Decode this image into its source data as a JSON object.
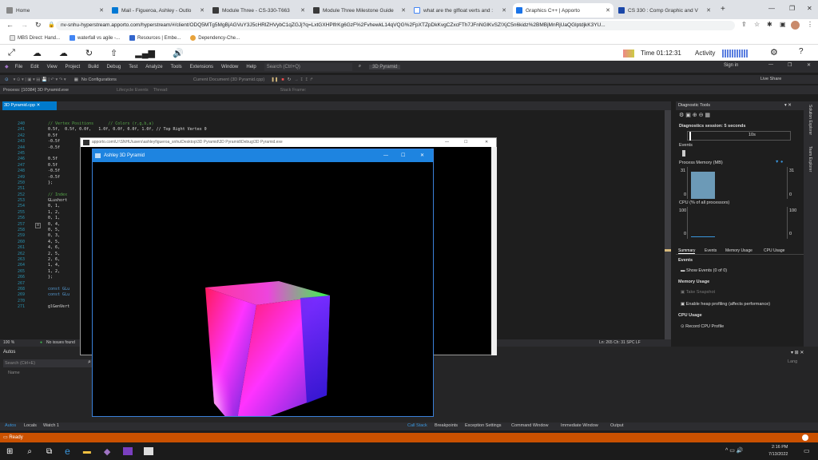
{
  "browser": {
    "tabs": [
      {
        "label": "Home",
        "color": "#888"
      },
      {
        "label": "Mail - Figueroa, Ashley - Outlo",
        "color": "#0078d4"
      },
      {
        "label": "Module Three - CS-330-T663",
        "color": "#3a3a3a"
      },
      {
        "label": "Module Three Milestone Guide",
        "color": "#3a3a3a"
      },
      {
        "label": "what are the glfloat verts and :",
        "color": "#4285f4"
      },
      {
        "label": "Graphics C++ | Apporto",
        "color": "#1a73e8"
      },
      {
        "label": "CS 330 : Comp Graphic and V",
        "color": "#1a47a8"
      }
    ],
    "url": "nv-snhu-hyperstream.apporto.com/hyperstream/#/client/ODQ5MTg5MgBjAGVuY3J5cHRlZHVybC1qZGJj?q=LxtGXHPlfrKg6GzF%2FvhewkL14qVQG%2FpXTZpDkKvgCZxcFTh7JFnNGlKvSZ!XjC5n6kidz%2BMBjMnRjUaQGlptdjkK3YU...",
    "bookmarks": [
      "MBS Direct: Hand...",
      "waterfall vs agile -...",
      "Resources | Embe...",
      "Dependency-Che..."
    ]
  },
  "rdp": {
    "time_label": "Time 01:12:31",
    "activity_label": "Activity"
  },
  "vs": {
    "menu": [
      "File",
      "Edit",
      "View",
      "Project",
      "Build",
      "Debug",
      "Test",
      "Analyze",
      "Tools",
      "Extensions",
      "Window",
      "Help"
    ],
    "search_placeholder": "Search (Ctrl+Q)",
    "solution_name": "3D Pyramid",
    "sign_in": "Sign in",
    "config": "No Configurations",
    "current_doc": "Current Document (3D Pyramid.cpp)",
    "process": "Process: [10384] 3D Pyramid.exe",
    "lifecycle": "Lifecycle Events",
    "thread": "Thread:",
    "stack_frame": "Stack Frame:",
    "live_share": "Live Share",
    "doc_tab": "3D Pyramid.cpp"
  },
  "editor": {
    "lines": [
      {
        "n": "240",
        "t": "// Vertex Positions      // Colors (r,g,b,a)",
        "c": "cmt"
      },
      {
        "n": "241",
        "t": "0.5f,  0.5f, 0.0f,   1.0f, 0.0f, 0.0f, 1.0f, // Top Right Vertex 0",
        "c": ""
      },
      {
        "n": "242",
        "t": "0.5f",
        "c": ""
      },
      {
        "n": "243",
        "t": "-0.5f",
        "c": ""
      },
      {
        "n": "244",
        "t": "-0.5f",
        "c": ""
      },
      {
        "n": "245",
        "t": "",
        "c": ""
      },
      {
        "n": "246",
        "t": "0.5f",
        "c": ""
      },
      {
        "n": "247",
        "t": "0.5f",
        "c": ""
      },
      {
        "n": "248",
        "t": "-0.5f",
        "c": ""
      },
      {
        "n": "249",
        "t": "-0.5f",
        "c": ""
      },
      {
        "n": "250",
        "t": "};",
        "c": ""
      },
      {
        "n": "251",
        "t": "",
        "c": ""
      },
      {
        "n": "252",
        "t": "// Index",
        "c": "cmt"
      },
      {
        "n": "253",
        "t": "GLushort",
        "c": ""
      },
      {
        "n": "254",
        "t": "0, 1,",
        "c": ""
      },
      {
        "n": "255",
        "t": "1, 2,",
        "c": ""
      },
      {
        "n": "256",
        "t": "0, 1,",
        "c": ""
      },
      {
        "n": "257",
        "t": "0, 4,",
        "c": ""
      },
      {
        "n": "258",
        "t": "0, 5,",
        "c": ""
      },
      {
        "n": "259",
        "t": "0, 3,",
        "c": ""
      },
      {
        "n": "260",
        "t": "4, 5,",
        "c": ""
      },
      {
        "n": "261",
        "t": "4, 6,",
        "c": ""
      },
      {
        "n": "262",
        "t": "2, 5,",
        "c": ""
      },
      {
        "n": "263",
        "t": "2, 6,",
        "c": ""
      },
      {
        "n": "264",
        "t": "1, 4,",
        "c": ""
      },
      {
        "n": "265",
        "t": "1, 2,",
        "c": ""
      },
      {
        "n": "266",
        "t": "};",
        "c": ""
      },
      {
        "n": "267",
        "t": "",
        "c": ""
      },
      {
        "n": "268",
        "t": "const GLu",
        "c": "kw"
      },
      {
        "n": "269",
        "t": "const GLu",
        "c": "kw"
      },
      {
        "n": "270",
        "t": "",
        "c": ""
      },
      {
        "n": "271",
        "t": "glGenVert",
        "c": ""
      }
    ],
    "zoom": "100 %",
    "issues": "No issues found",
    "position": "Ln: 265   Ch: 31   SPC   LF"
  },
  "autos": {
    "title": "Autos",
    "search_placeholder": "Search (Ctrl+E)",
    "col_name": "Name",
    "col_lang": "Lang",
    "tabs_left": [
      "Autos",
      "Locals",
      "Watch 1"
    ],
    "tabs_right": [
      "Call Stack",
      "Breakpoints",
      "Exception Settings",
      "Command Window",
      "Immediate Window",
      "Output"
    ]
  },
  "diagnostics": {
    "title": "Diagnostic Tools",
    "session": "Diagnostics session: 5 seconds",
    "time_tick": "10s",
    "events": "Events",
    "process_memory": "Process Memory (MB)",
    "mem_max": "31",
    "mem_min": "0",
    "cpu": "CPU (% of all processors)",
    "cpu_max": "100",
    "cpu_min": "0",
    "tabs": [
      "Summary",
      "Events",
      "Memory Usage",
      "CPU Usage"
    ],
    "events_header": "Events",
    "show_events": "Show Events (0 of 0)",
    "memory_header": "Memory Usage",
    "take_snapshot": "Take Snapshot",
    "heap_profiling": "Enable heap profiling (affects performance)",
    "cpu_header": "CPU Usage",
    "record_cpu": "Record CPU Profile",
    "side_tabs": [
      "Solution Explorer",
      "Team Explorer"
    ]
  },
  "console_window": {
    "title": "apporto.com\\U:\\SNHU\\users\\ashleyfigueroa_snhu\\Desktop\\3D Pyramid\\3D Pyramid\\Debug\\3D Pyramid.exe"
  },
  "gl_window": {
    "title": "Ashley 3D Pyramid"
  },
  "status": {
    "ready": "Ready"
  },
  "tray": {
    "time": "2:16 PM",
    "date": "7/13/2022"
  },
  "colors": {
    "vs_accent": "#007acc",
    "status_orange": "#ca5100",
    "gl_titlebar": "#1e84e0"
  }
}
